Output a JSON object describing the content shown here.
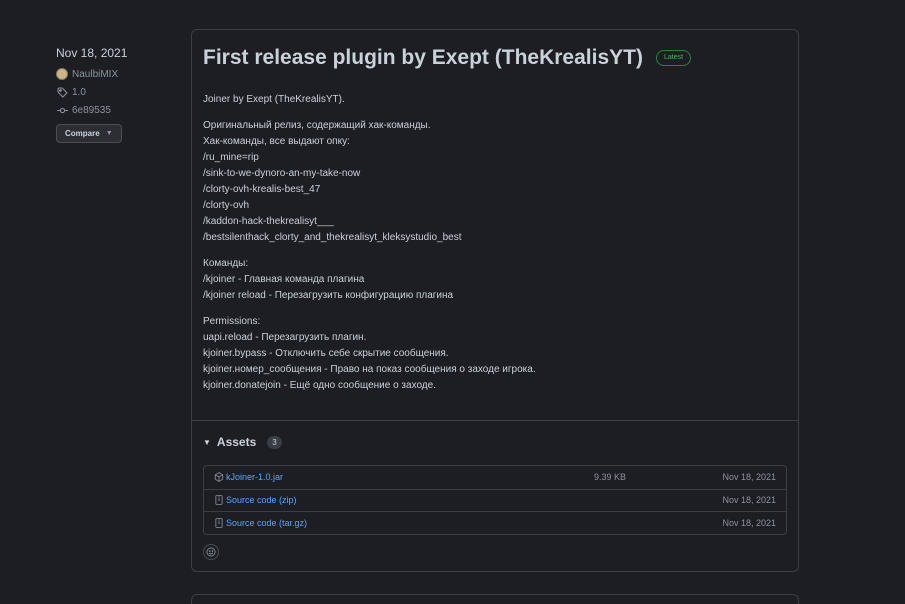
{
  "meta": {
    "date": "Nov 18, 2021",
    "author": "NaulbiMIX",
    "tag": "1.0",
    "commit": "6e89535",
    "compare_label": "Compare"
  },
  "release": {
    "title": "First release plugin by Exept (TheKrealisYT)",
    "badge": "Latest",
    "intro": "Joiner by Exept (TheKrealisYT).",
    "block1": [
      "Оригинальный релиз, содержащий хак-команды.",
      "Хак-команды, все выдают опку:",
      "/ru_mine=rip",
      "/sink-to-we-dynoro-an-my-take-now",
      "/clorty-ovh-krealis-best_47",
      "/clorty-ovh",
      "/kaddon-hack-thekrealisyt___",
      "/bestsilenthack_clorty_and_thekrealisyt_kleksystudio_best"
    ],
    "block2": [
      "Команды:",
      "/kjoiner - Главная команда плагина",
      "/kjoiner reload - Перезагрузить конфигурацию плагина"
    ],
    "block3": [
      "Permissions:",
      "uapi.reload - Перезагрузить плагин.",
      "kjoiner.bypass - Отключить себе скрытие сообщения.",
      "kjoiner.номер_сообщения - Право на показ сообщения о заходе игрока.",
      "kjoiner.donatejoin - Ещё одно сообщение о заходе."
    ]
  },
  "assets": {
    "label": "Assets",
    "count": "3",
    "items": [
      {
        "icon": "package-icon",
        "name": "kJoiner-1.0.jar",
        "size": "9.39 KB",
        "date": "Nov 18, 2021"
      },
      {
        "icon": "file-zip-icon",
        "name": "Source code (zip)",
        "size": "",
        "date": "Nov 18, 2021"
      },
      {
        "icon": "file-zip-icon",
        "name": "Source code (tar.gz)",
        "size": "",
        "date": "Nov 18, 2021"
      }
    ]
  },
  "colors": {
    "background": "#1d1e23",
    "border": "#3b3e45",
    "link": "#58a6ff",
    "latest_badge": "#3fb950"
  }
}
